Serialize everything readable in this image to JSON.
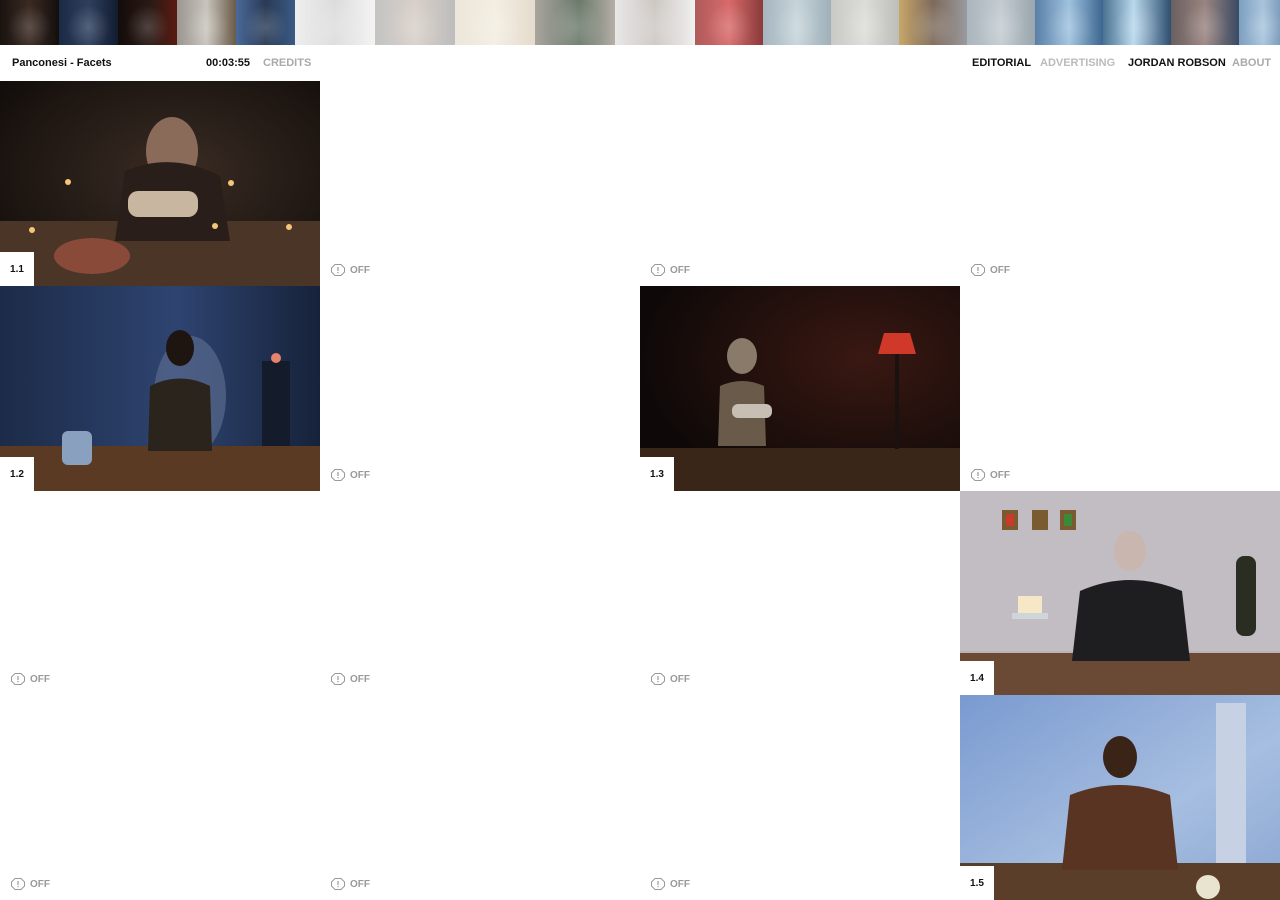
{
  "header": {
    "project_title": "Panconesi - Facets",
    "timecode": "00:03:55",
    "credits_label": "CREDITS",
    "nav": {
      "editorial": "EDITORIAL",
      "advertising": "ADVERTISING",
      "name": "JORDAN ROBSON",
      "about": "ABOUT"
    }
  },
  "cells": {
    "c11": {
      "label": "1.1"
    },
    "c12": {
      "off": "OFF"
    },
    "c13": {
      "off": "OFF"
    },
    "c14": {
      "off": "OFF"
    },
    "c21": {
      "label": "1.2"
    },
    "c22": {
      "off": "OFF"
    },
    "c23": {
      "label": "1.3"
    },
    "c24": {
      "off": "OFF"
    },
    "c31": {
      "off": "OFF"
    },
    "c32": {
      "off": "OFF"
    },
    "c33": {
      "off": "OFF"
    },
    "c34": {
      "label": "1.4"
    },
    "c41": {
      "off": "OFF"
    },
    "c42": {
      "off": "OFF"
    },
    "c43": {
      "off": "OFF"
    },
    "c44": {
      "label": "1.5"
    }
  },
  "colors": {
    "text": "#111111",
    "muted": "#aaaaaa",
    "background": "#ffffff"
  }
}
